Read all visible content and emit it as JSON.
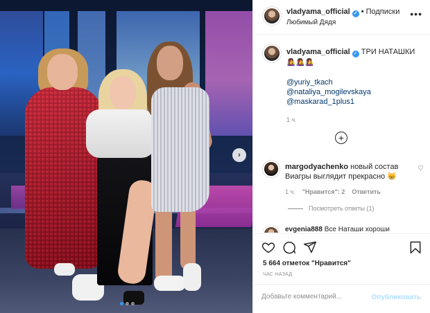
{
  "post": {
    "username": "vladyama_official",
    "follow_label": "Подписки",
    "separator": "•",
    "subtitle": "Любимый Дядя",
    "caption": {
      "text": "ТРИ НАТАШКИ",
      "emojis": "👩‍🎤👩‍🎤👩‍🎤",
      "mentions": [
        "@yuriy_tkach",
        "@nataliya_mogilevskaya",
        "@maskarad_1plus1"
      ],
      "time": "1 ч."
    },
    "comments": [
      {
        "username": "margodyachenko",
        "text": "новый состав Виагры выглядит прекрасно",
        "emoji": "😸",
        "time": "1 ч.",
        "likes": "\"Нравится\": 2",
        "reply": "Ответить",
        "view_replies": "Посмотреть ответы (1)"
      },
      {
        "username": "еvgeniа888",
        "text": "Все Наташи хороши"
      }
    ],
    "likes_count": "5 664 отметок \"Нравится\"",
    "posted_ago": "ЧАС НАЗАД",
    "add_comment_placeholder": "Добавьте комментарий...",
    "publish_label": "Опубликовать"
  },
  "colors": {
    "accent": "#3897f0",
    "mention": "#00376b",
    "muted": "#8e8e8e",
    "publish_disabled": "#b2dffc"
  },
  "icons": [
    "verified-icon",
    "more-icon",
    "next-photo-icon",
    "heart-icon",
    "comment-icon",
    "share-icon",
    "bookmark-icon",
    "plus-circle-icon"
  ]
}
